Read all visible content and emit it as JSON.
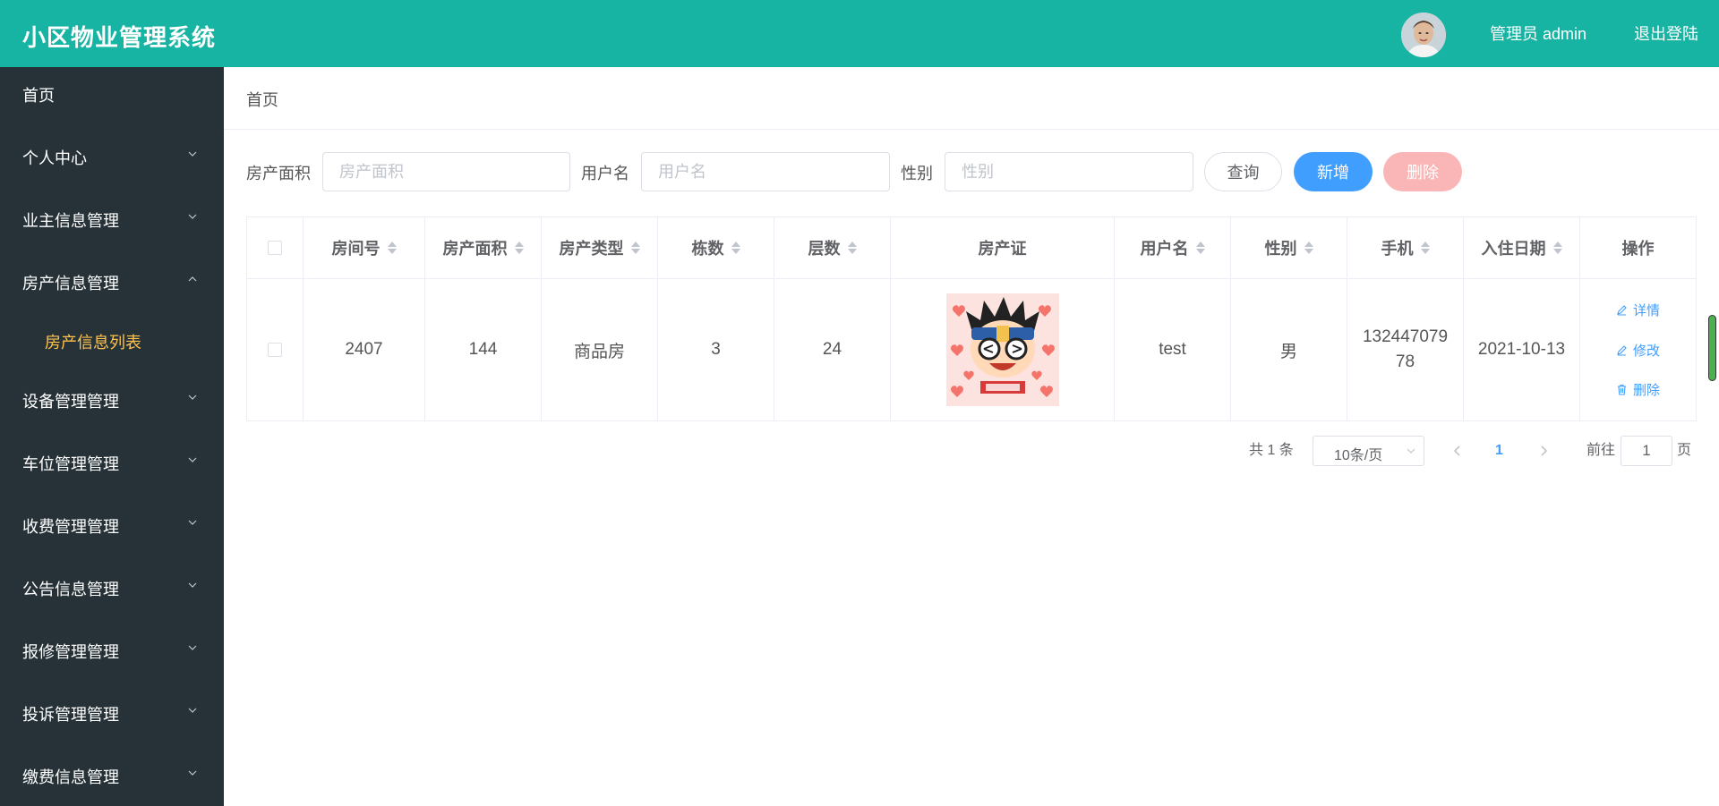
{
  "header": {
    "app_title": "小区物业管理系统",
    "user_label": "管理员 admin",
    "logout_label": "退出登陆"
  },
  "sidebar": {
    "items": [
      {
        "label": "首页"
      },
      {
        "label": "个人中心"
      },
      {
        "label": "业主信息管理"
      },
      {
        "label": "房产信息管理"
      },
      {
        "label": "设备管理管理"
      },
      {
        "label": "车位管理管理"
      },
      {
        "label": "收费管理管理"
      },
      {
        "label": "公告信息管理"
      },
      {
        "label": "报修管理管理"
      },
      {
        "label": "投诉管理管理"
      },
      {
        "label": "缴费信息管理"
      }
    ],
    "active_subitem": "房产信息列表"
  },
  "breadcrumb": "首页",
  "filters": {
    "area_label": "房产面积",
    "area_placeholder": "房产面积",
    "username_label": "用户名",
    "username_placeholder": "用户名",
    "gender_label": "性别",
    "gender_placeholder": "性别",
    "query_label": "查询",
    "add_label": "新增",
    "delete_label": "删除"
  },
  "table": {
    "columns": [
      "房间号",
      "房产面积",
      "房产类型",
      "栋数",
      "层数",
      "房产证",
      "用户名",
      "性别",
      "手机",
      "入住日期",
      "操作"
    ],
    "rows": [
      {
        "room_no": "2407",
        "area": "144",
        "type": "商品房",
        "building": "3",
        "floor": "24",
        "certificate_image": "cartoon-avatar",
        "username": "test",
        "gender": "男",
        "phone": "13244707978",
        "checkin_date": "2021-10-13",
        "actions": [
          "详情",
          "修改",
          "删除"
        ]
      }
    ]
  },
  "pagination": {
    "total_text": "共 1 条",
    "page_size": "10条/页",
    "current_page": "1",
    "goto_label": "前往",
    "goto_value": "1",
    "page_suffix": "页"
  },
  "colors": {
    "header_bg": "#17b3a3",
    "sidebar_bg": "#263238",
    "active_submenu": "#ffc34d",
    "primary": "#409eff",
    "danger_disabled": "#fab6b6"
  }
}
